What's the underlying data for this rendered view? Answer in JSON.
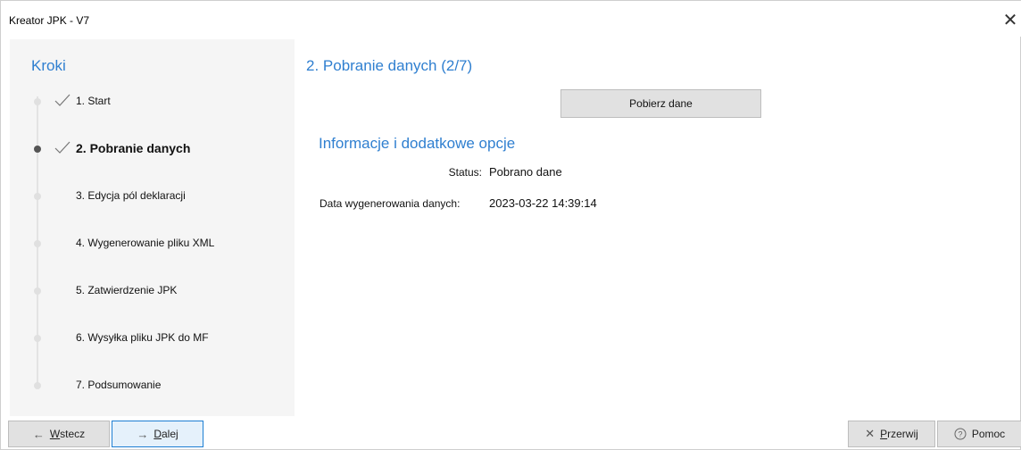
{
  "window": {
    "title": "Kreator JPK - V7",
    "close_icon": "✕"
  },
  "sidebar": {
    "heading": "Kroki",
    "steps": [
      {
        "label": "1. Start",
        "done": true,
        "active": false
      },
      {
        "label": "2. Pobranie danych",
        "done": true,
        "active": true
      },
      {
        "label": "3. Edycja pól deklaracji",
        "done": false,
        "active": false
      },
      {
        "label": "4. Wygenerowanie pliku XML",
        "done": false,
        "active": false
      },
      {
        "label": "5. Zatwierdzenie JPK",
        "done": false,
        "active": false
      },
      {
        "label": "6. Wysyłka pliku JPK do MF",
        "done": false,
        "active": false
      },
      {
        "label": "7. Podsumowanie",
        "done": false,
        "active": false
      }
    ]
  },
  "main": {
    "title": "2. Pobranie danych (2/7)",
    "fetch_button": "Pobierz dane",
    "info_heading": "Informacje i dodatkowe opcje",
    "status_label": "Status:",
    "status_value": "Pobrano dane",
    "date_label": "Data wygenerowania danych:",
    "date_value": "2023-03-22 14:39:14"
  },
  "footer": {
    "back": {
      "icon": "←",
      "underlined": "W",
      "rest": "stecz"
    },
    "next": {
      "icon": "→",
      "underlined": "D",
      "rest": "alej"
    },
    "cancel": {
      "icon": "✕",
      "underlined": "P",
      "rest": "rzerwij"
    },
    "help": {
      "icon": "?",
      "underlined": "",
      "rest": "Pomoc"
    }
  },
  "colors": {
    "accent": "#2f7fd0",
    "sidebar_bg": "#f5f5f5",
    "button_bg": "#e1e1e1",
    "focus_border": "#1e7fd3"
  }
}
